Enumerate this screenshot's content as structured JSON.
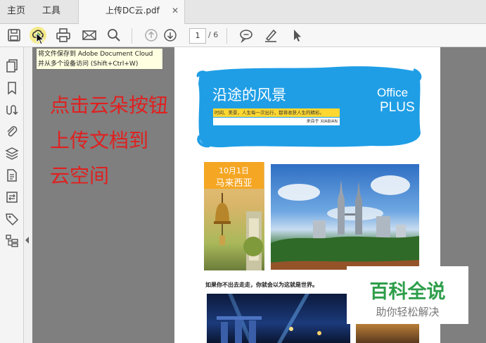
{
  "tabs": {
    "home": "主页",
    "tools": "工具",
    "document": "上传DC云.pdf"
  },
  "toolbar": {
    "tools": [
      "save-icon",
      "cloud-upload-icon",
      "print-icon",
      "email-icon",
      "search-icon",
      "page-up-icon",
      "page-down-icon",
      "comment-icon",
      "highlight-pen-icon",
      "select-pointer-icon"
    ],
    "current_page": "1",
    "total_pages": "/ 6"
  },
  "tooltip": {
    "line1": "将文件保存到 Adobe Document Cloud",
    "line2": "并从多个设备访问 (Shift+Ctrl+W)"
  },
  "instruction": {
    "line1": "点击云朵按钮",
    "line2": "上传文档到",
    "line3": "云空间"
  },
  "document": {
    "banner_title": "沿途的风景",
    "brand_word1": "Office",
    "brand_word2": "PLUS",
    "quote": "时间、美景，人生每一次出行，都将收获人生的精彩。",
    "quote_source": "来自于 XIABIAN",
    "date": "10月1日",
    "place": "马来西亚",
    "caption": "如果你不出去走走，你就会以为这就是世界。"
  },
  "watermark": {
    "main": "百科全说",
    "sub": "助你轻松解决"
  },
  "colors": {
    "banner_blue": "#1f9ee6",
    "badge_orange": "#f5a623",
    "instruction_red": "#e02020",
    "watermark_green": "#2e9e4a"
  }
}
